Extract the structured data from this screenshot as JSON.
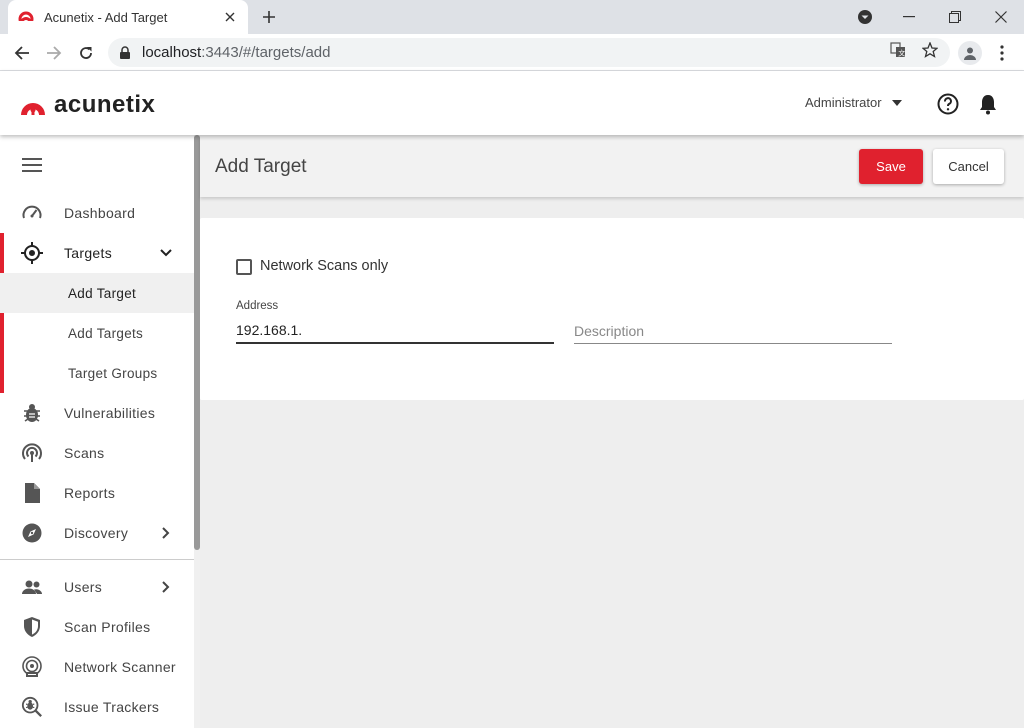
{
  "browser": {
    "tab_title": "Acunetix - Add Target",
    "url_host": "localhost",
    "url_rest": ":3443/#/targets/add"
  },
  "header": {
    "brand": "acunetix",
    "user": "Administrator"
  },
  "sidebar": {
    "items": [
      {
        "label": "Dashboard",
        "icon": "speedometer-icon"
      },
      {
        "label": "Targets",
        "icon": "crosshair-icon"
      },
      {
        "label": "Vulnerabilities",
        "icon": "bug-icon"
      },
      {
        "label": "Scans",
        "icon": "radar-icon"
      },
      {
        "label": "Reports",
        "icon": "document-icon"
      },
      {
        "label": "Discovery",
        "icon": "compass-icon"
      },
      {
        "label": "Users",
        "icon": "users-icon"
      },
      {
        "label": "Scan Profiles",
        "icon": "shield-icon"
      },
      {
        "label": "Network Scanner",
        "icon": "network-scanner-icon"
      },
      {
        "label": "Issue Trackers",
        "icon": "issue-tracker-icon"
      }
    ],
    "subitems": [
      {
        "label": "Add Target",
        "active": true
      },
      {
        "label": "Add Targets"
      },
      {
        "label": "Target Groups"
      }
    ]
  },
  "main": {
    "title": "Add Target",
    "save_label": "Save",
    "cancel_label": "Cancel",
    "network_scans_label": "Network Scans only",
    "network_scans_checked": false,
    "address_label": "Address",
    "address_value": "192.168.1.",
    "description_placeholder": "Description"
  },
  "colors": {
    "accent": "#e0212e"
  }
}
